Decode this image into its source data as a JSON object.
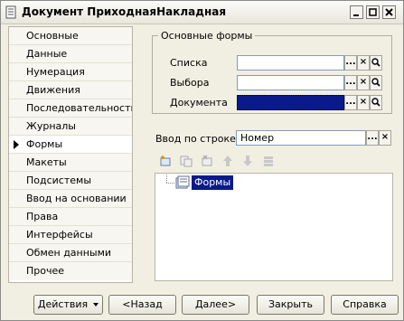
{
  "window": {
    "title": "Документ ПриходнаяНакладная",
    "controls": [
      "_",
      "□",
      "×"
    ]
  },
  "nav": {
    "items": [
      {
        "label": "Основные"
      },
      {
        "label": "Данные"
      },
      {
        "label": "Нумерация"
      },
      {
        "label": "Движения"
      },
      {
        "label": "Последовательности"
      },
      {
        "label": "Журналы"
      },
      {
        "label": "Формы",
        "active": true
      },
      {
        "label": "Макеты"
      },
      {
        "label": "Подсистемы"
      },
      {
        "label": "Ввод на основании"
      },
      {
        "label": "Права"
      },
      {
        "label": "Интерфейсы"
      },
      {
        "label": "Обмен данными"
      },
      {
        "label": "Прочее"
      }
    ]
  },
  "main_forms": {
    "title": "Основные формы",
    "rows": [
      {
        "label": "Списка",
        "value": ""
      },
      {
        "label": "Выбора",
        "value": ""
      },
      {
        "label": "Документа",
        "value": ""
      }
    ],
    "btn_select": "...",
    "btn_clear": "×"
  },
  "input_by_string": {
    "label": "Ввод по строке",
    "value": "Номер"
  },
  "forms_tree": {
    "toolbar_icons": [
      "add-icon",
      "copy-icon",
      "delete-icon",
      "move-up-icon",
      "move-down-icon",
      "sort-icon"
    ],
    "items": [
      {
        "label": "Формы",
        "selected": true,
        "icon": "forms-folder-icon"
      }
    ]
  },
  "buttons": {
    "actions": "Действия",
    "back": "<Назад",
    "next": "Далее>",
    "close": "Закрыть",
    "help": "Справка"
  },
  "colors": {
    "selection": "#0a1a8c",
    "window_bg": "#f1efe2"
  }
}
